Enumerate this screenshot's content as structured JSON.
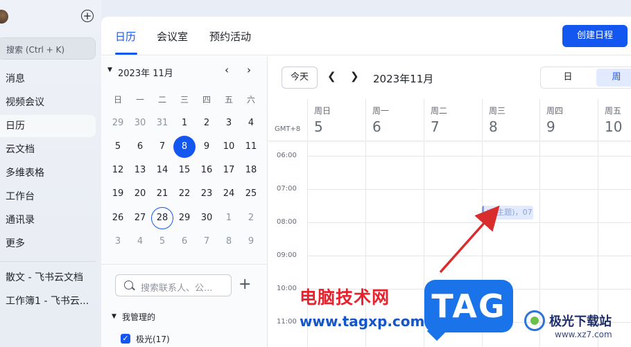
{
  "sidebar": {
    "search_placeholder": "搜索 (Ctrl + K)",
    "items": [
      {
        "label": "消息"
      },
      {
        "label": "视频会议"
      },
      {
        "label": "日历"
      },
      {
        "label": "云文档"
      },
      {
        "label": "多维表格"
      },
      {
        "label": "工作台"
      },
      {
        "label": "通讯录"
      },
      {
        "label": "更多"
      }
    ],
    "recent": [
      {
        "label": "散文 - 飞书云文档"
      },
      {
        "label": "工作簿1 - 飞书云..."
      }
    ]
  },
  "header": {
    "tabs": [
      {
        "label": "日历"
      },
      {
        "label": "会议室"
      },
      {
        "label": "预约活动"
      }
    ],
    "create_label": "创建日程"
  },
  "mini_calendar": {
    "month_label": "2023年 11月",
    "prev_glyph": "‹",
    "next_glyph": "›",
    "weekdays": [
      "日",
      "一",
      "二",
      "三",
      "四",
      "五",
      "六"
    ],
    "weeks": [
      [
        "29",
        "30",
        "31",
        "1",
        "2",
        "3",
        "4"
      ],
      [
        "5",
        "6",
        "7",
        "8",
        "9",
        "10",
        "11"
      ],
      [
        "12",
        "13",
        "14",
        "15",
        "16",
        "17",
        "18"
      ],
      [
        "19",
        "20",
        "21",
        "22",
        "23",
        "24",
        "25"
      ],
      [
        "26",
        "27",
        "28",
        "29",
        "30",
        "1",
        "2"
      ],
      [
        "3",
        "4",
        "5",
        "6",
        "7",
        "8",
        "9"
      ]
    ],
    "contact_search_placeholder": "搜索联系人、公...",
    "managed_label": "我管理的",
    "calendars": [
      {
        "name": "极光(17)",
        "checked": true
      }
    ]
  },
  "week_view": {
    "today_label": "今天",
    "range_label": "2023年11月",
    "view_day_label": "日",
    "view_week_label": "周",
    "timezone_label": "GMT+8",
    "columns": [
      {
        "weekday": "周日",
        "date": "5"
      },
      {
        "weekday": "周一",
        "date": "6"
      },
      {
        "weekday": "周二",
        "date": "7"
      },
      {
        "weekday": "周三",
        "date": "8"
      },
      {
        "weekday": "周四",
        "date": "9"
      },
      {
        "weekday": "周五",
        "date": "10"
      }
    ],
    "hours": [
      "06:00",
      "07:00",
      "08:00",
      "09:00",
      "10:00",
      "11:00"
    ],
    "event": {
      "title": "(无主题)，07"
    }
  },
  "overlay": {
    "watermark_text": "电脑技术网",
    "watermark_url": "www.tagxp.com",
    "tag_logo": "TAG",
    "site_name": "极光下载站",
    "site_url": "www.xz7.com"
  },
  "colors": {
    "accent": "#1456f0",
    "arrow": "#d92d2d",
    "watermark_red": "#e8212c"
  }
}
